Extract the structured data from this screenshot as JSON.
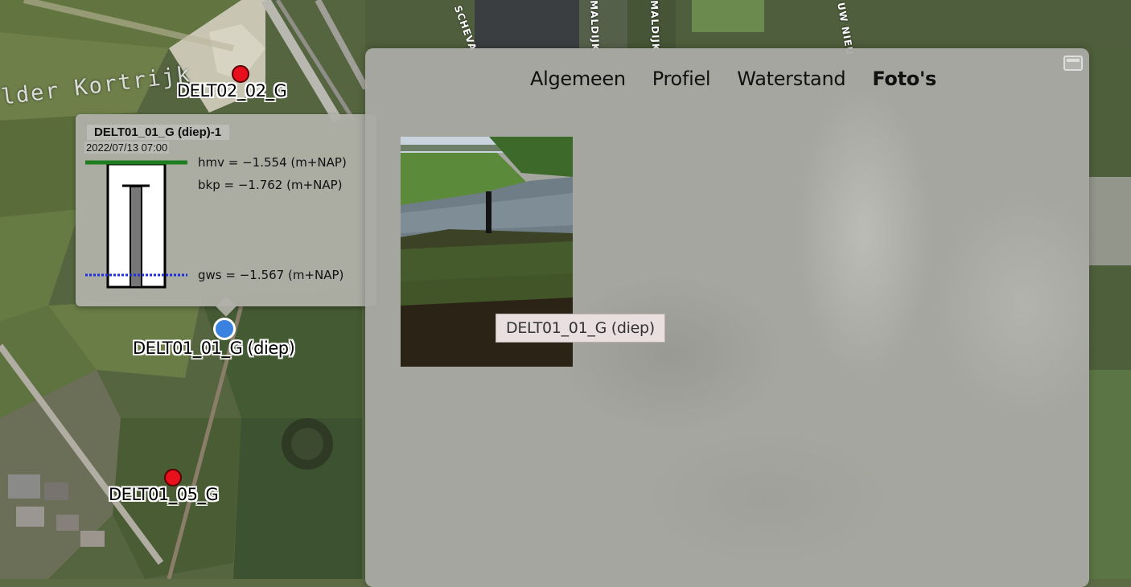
{
  "map": {
    "area_label": "lder Kortrijk",
    "street_labels": [
      "SCHEVA",
      "MALDIJK",
      "MALDIJK",
      "UW NIEU"
    ],
    "markers": [
      {
        "label": "DELT02_02_G",
        "color": "#e8101c",
        "selected": false
      },
      {
        "label": "DELT01_01_G (diep)",
        "color": "#3b82e0",
        "selected": true
      },
      {
        "label": "DELT01_05_G",
        "color": "#e8101c",
        "selected": false
      }
    ]
  },
  "popup": {
    "title": "DELT01_01_G (diep)-1",
    "datetime": "2022/07/13 07:00",
    "hmv": "hmv = −1.554 (m+NAP)",
    "bkp": "bkp = −1.762 (m+NAP)",
    "gws": "gws = −1.567 (m+NAP)",
    "colors": {
      "hmv_line": "#1e7d1e",
      "gws_line": "#1e2fe0"
    }
  },
  "panel": {
    "tabs": [
      {
        "label": "Algemeen",
        "active": false
      },
      {
        "label": "Profiel",
        "active": false
      },
      {
        "label": "Waterstand",
        "active": false
      },
      {
        "label": "Foto's",
        "active": true
      }
    ],
    "photo_tooltip": "DELT01_01_G (diep)"
  }
}
